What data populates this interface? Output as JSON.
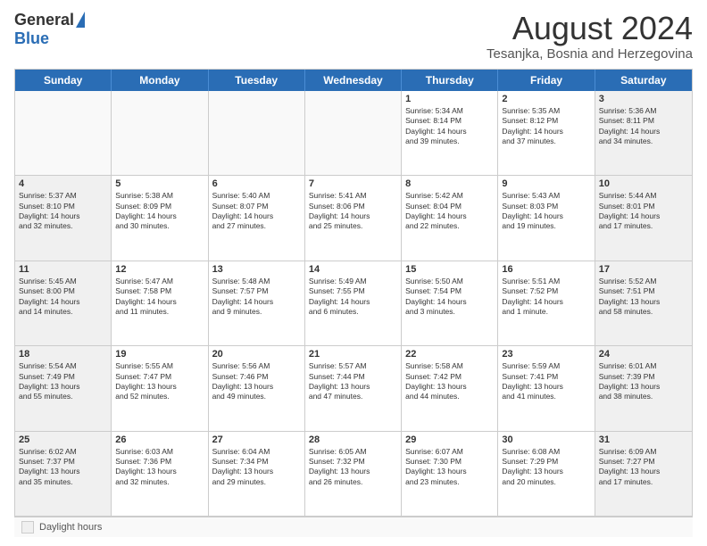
{
  "logo": {
    "general": "General",
    "blue": "Blue"
  },
  "title": "August 2024",
  "subtitle": "Tesanjka, Bosnia and Herzegovina",
  "days": [
    "Sunday",
    "Monday",
    "Tuesday",
    "Wednesday",
    "Thursday",
    "Friday",
    "Saturday"
  ],
  "legend_box_label": "Daylight hours",
  "weeks": [
    [
      {
        "day": "",
        "text": ""
      },
      {
        "day": "",
        "text": ""
      },
      {
        "day": "",
        "text": ""
      },
      {
        "day": "",
        "text": ""
      },
      {
        "day": "1",
        "text": "Sunrise: 5:34 AM\nSunset: 8:14 PM\nDaylight: 14 hours\nand 39 minutes."
      },
      {
        "day": "2",
        "text": "Sunrise: 5:35 AM\nSunset: 8:12 PM\nDaylight: 14 hours\nand 37 minutes."
      },
      {
        "day": "3",
        "text": "Sunrise: 5:36 AM\nSunset: 8:11 PM\nDaylight: 14 hours\nand 34 minutes."
      }
    ],
    [
      {
        "day": "4",
        "text": "Sunrise: 5:37 AM\nSunset: 8:10 PM\nDaylight: 14 hours\nand 32 minutes."
      },
      {
        "day": "5",
        "text": "Sunrise: 5:38 AM\nSunset: 8:09 PM\nDaylight: 14 hours\nand 30 minutes."
      },
      {
        "day": "6",
        "text": "Sunrise: 5:40 AM\nSunset: 8:07 PM\nDaylight: 14 hours\nand 27 minutes."
      },
      {
        "day": "7",
        "text": "Sunrise: 5:41 AM\nSunset: 8:06 PM\nDaylight: 14 hours\nand 25 minutes."
      },
      {
        "day": "8",
        "text": "Sunrise: 5:42 AM\nSunset: 8:04 PM\nDaylight: 14 hours\nand 22 minutes."
      },
      {
        "day": "9",
        "text": "Sunrise: 5:43 AM\nSunset: 8:03 PM\nDaylight: 14 hours\nand 19 minutes."
      },
      {
        "day": "10",
        "text": "Sunrise: 5:44 AM\nSunset: 8:01 PM\nDaylight: 14 hours\nand 17 minutes."
      }
    ],
    [
      {
        "day": "11",
        "text": "Sunrise: 5:45 AM\nSunset: 8:00 PM\nDaylight: 14 hours\nand 14 minutes."
      },
      {
        "day": "12",
        "text": "Sunrise: 5:47 AM\nSunset: 7:58 PM\nDaylight: 14 hours\nand 11 minutes."
      },
      {
        "day": "13",
        "text": "Sunrise: 5:48 AM\nSunset: 7:57 PM\nDaylight: 14 hours\nand 9 minutes."
      },
      {
        "day": "14",
        "text": "Sunrise: 5:49 AM\nSunset: 7:55 PM\nDaylight: 14 hours\nand 6 minutes."
      },
      {
        "day": "15",
        "text": "Sunrise: 5:50 AM\nSunset: 7:54 PM\nDaylight: 14 hours\nand 3 minutes."
      },
      {
        "day": "16",
        "text": "Sunrise: 5:51 AM\nSunset: 7:52 PM\nDaylight: 14 hours\nand 1 minute."
      },
      {
        "day": "17",
        "text": "Sunrise: 5:52 AM\nSunset: 7:51 PM\nDaylight: 13 hours\nand 58 minutes."
      }
    ],
    [
      {
        "day": "18",
        "text": "Sunrise: 5:54 AM\nSunset: 7:49 PM\nDaylight: 13 hours\nand 55 minutes."
      },
      {
        "day": "19",
        "text": "Sunrise: 5:55 AM\nSunset: 7:47 PM\nDaylight: 13 hours\nand 52 minutes."
      },
      {
        "day": "20",
        "text": "Sunrise: 5:56 AM\nSunset: 7:46 PM\nDaylight: 13 hours\nand 49 minutes."
      },
      {
        "day": "21",
        "text": "Sunrise: 5:57 AM\nSunset: 7:44 PM\nDaylight: 13 hours\nand 47 minutes."
      },
      {
        "day": "22",
        "text": "Sunrise: 5:58 AM\nSunset: 7:42 PM\nDaylight: 13 hours\nand 44 minutes."
      },
      {
        "day": "23",
        "text": "Sunrise: 5:59 AM\nSunset: 7:41 PM\nDaylight: 13 hours\nand 41 minutes."
      },
      {
        "day": "24",
        "text": "Sunrise: 6:01 AM\nSunset: 7:39 PM\nDaylight: 13 hours\nand 38 minutes."
      }
    ],
    [
      {
        "day": "25",
        "text": "Sunrise: 6:02 AM\nSunset: 7:37 PM\nDaylight: 13 hours\nand 35 minutes."
      },
      {
        "day": "26",
        "text": "Sunrise: 6:03 AM\nSunset: 7:36 PM\nDaylight: 13 hours\nand 32 minutes."
      },
      {
        "day": "27",
        "text": "Sunrise: 6:04 AM\nSunset: 7:34 PM\nDaylight: 13 hours\nand 29 minutes."
      },
      {
        "day": "28",
        "text": "Sunrise: 6:05 AM\nSunset: 7:32 PM\nDaylight: 13 hours\nand 26 minutes."
      },
      {
        "day": "29",
        "text": "Sunrise: 6:07 AM\nSunset: 7:30 PM\nDaylight: 13 hours\nand 23 minutes."
      },
      {
        "day": "30",
        "text": "Sunrise: 6:08 AM\nSunset: 7:29 PM\nDaylight: 13 hours\nand 20 minutes."
      },
      {
        "day": "31",
        "text": "Sunrise: 6:09 AM\nSunset: 7:27 PM\nDaylight: 13 hours\nand 17 minutes."
      }
    ]
  ]
}
